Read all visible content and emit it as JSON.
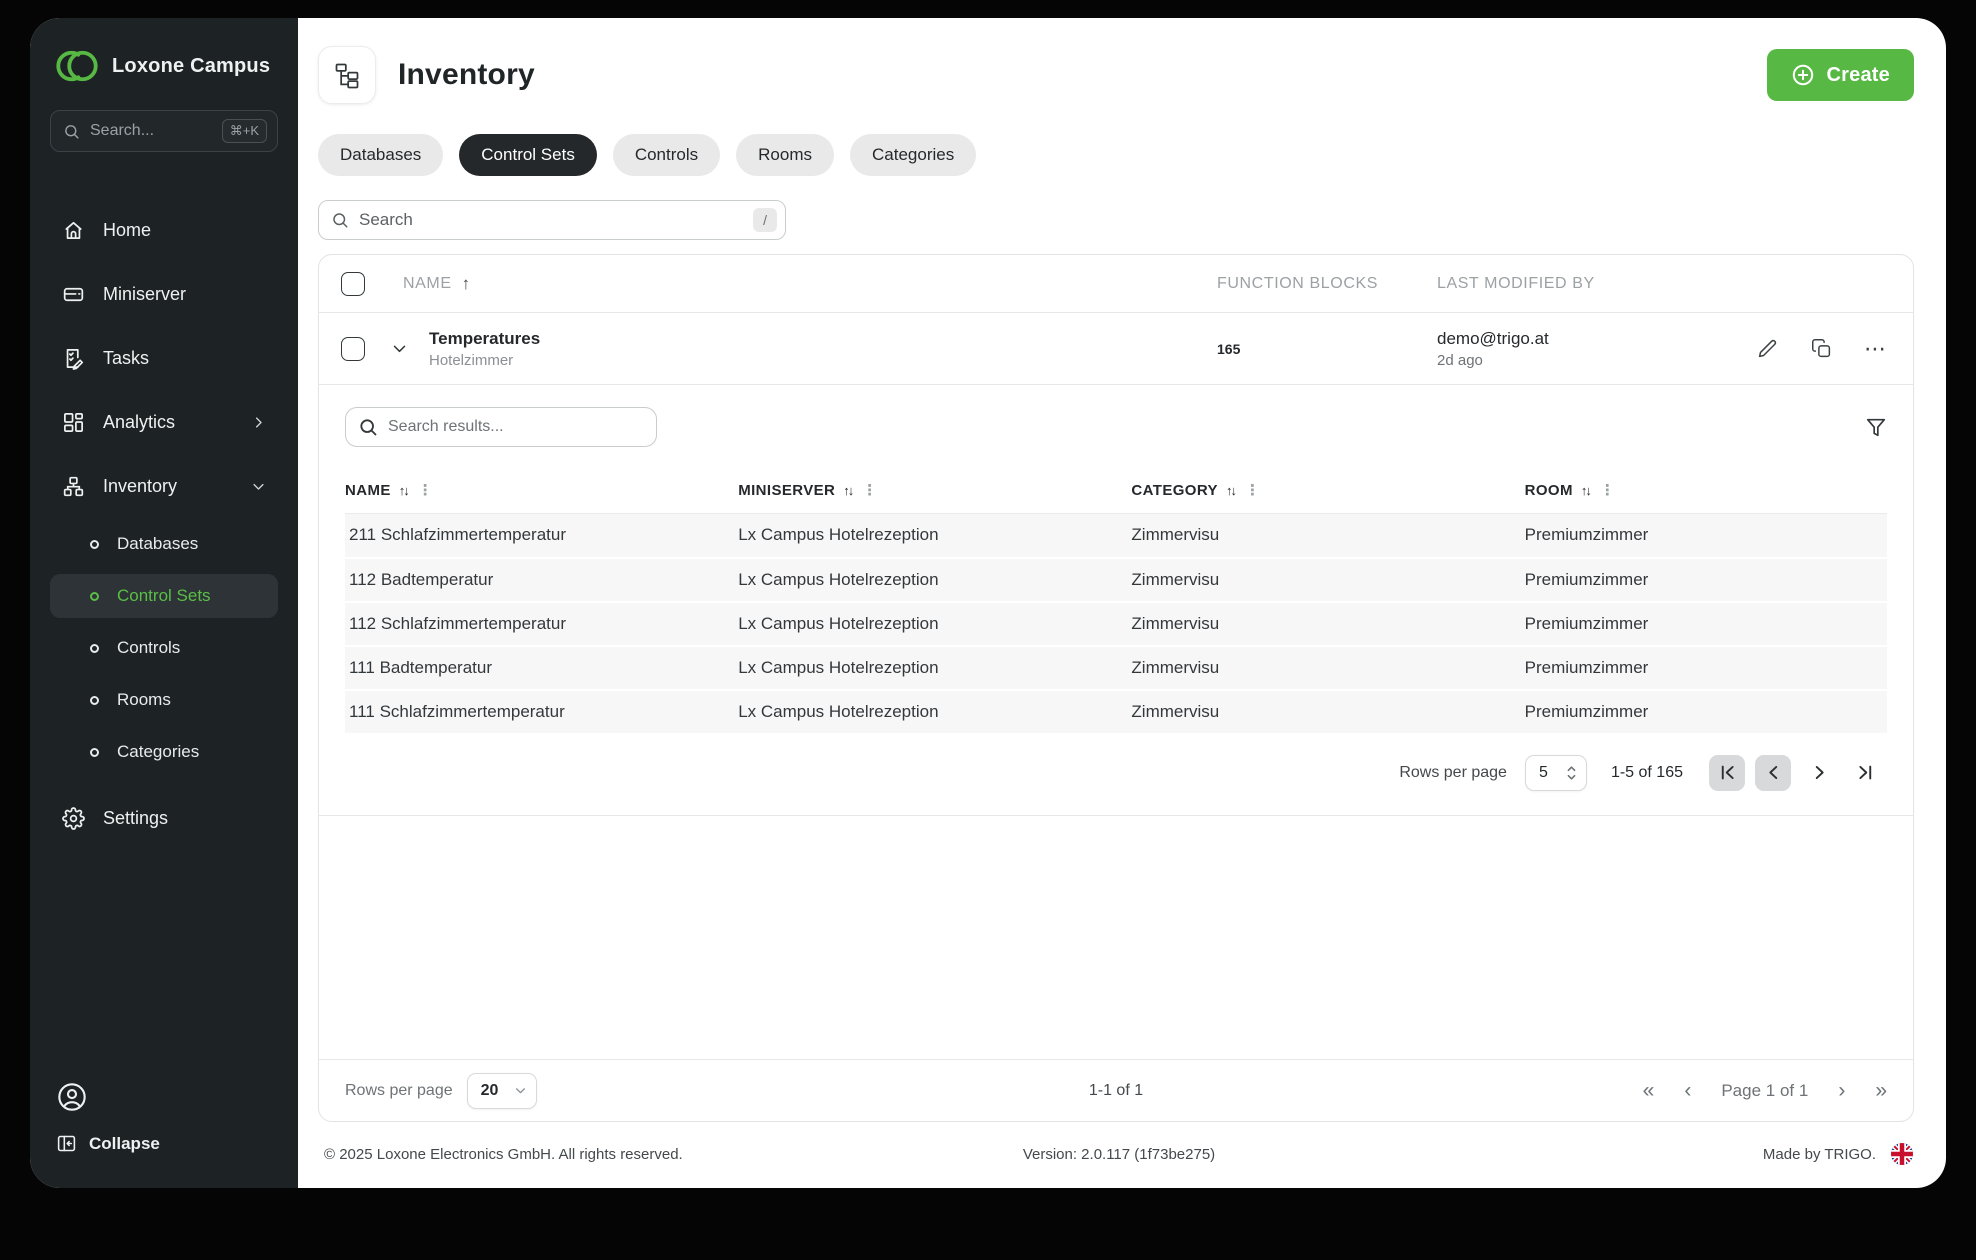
{
  "app": {
    "brand": "Loxone Campus"
  },
  "colors": {
    "accent_green": "#57b843",
    "sidebar_bg": "#1d2224",
    "active_tab_bg": "#24282b"
  },
  "sidebar": {
    "search": {
      "placeholder": "Search...",
      "shortcut": "⌘+K"
    },
    "items": [
      {
        "label": "Home"
      },
      {
        "label": "Miniserver"
      },
      {
        "label": "Tasks"
      },
      {
        "label": "Analytics"
      },
      {
        "label": "Inventory"
      }
    ],
    "inventory_children": [
      {
        "label": "Databases"
      },
      {
        "label": "Control Sets"
      },
      {
        "label": "Controls"
      },
      {
        "label": "Rooms"
      },
      {
        "label": "Categories"
      }
    ],
    "settings_label": "Settings",
    "collapse_label": "Collapse"
  },
  "header": {
    "title": "Inventory",
    "create_label": "Create"
  },
  "tabs": [
    {
      "label": "Databases"
    },
    {
      "label": "Control Sets"
    },
    {
      "label": "Controls"
    },
    {
      "label": "Rooms"
    },
    {
      "label": "Categories"
    }
  ],
  "search": {
    "placeholder": "Search",
    "shortcut": "/"
  },
  "table": {
    "headers": {
      "name": "NAME",
      "function_blocks": "FUNCTION BLOCKS",
      "last_modified_by": "LAST MODIFIED BY"
    },
    "row": {
      "name": "Temperatures",
      "subtitle": "Hotelzimmer",
      "function_blocks": "165",
      "modified_by": "demo@trigo.at",
      "modified_when": "2d ago"
    }
  },
  "subtable": {
    "search_placeholder": "Search results...",
    "columns": {
      "name": "NAME",
      "miniserver": "MINISERVER",
      "category": "CATEGORY",
      "room": "ROOM"
    },
    "rows": [
      {
        "name": "211 Schlafzimmertemperatur",
        "miniserver": "Lx Campus Hotelrezeption",
        "category": "Zimmervisu",
        "room": "Premiumzimmer"
      },
      {
        "name": "112 Badtemperatur",
        "miniserver": "Lx Campus Hotelrezeption",
        "category": "Zimmervisu",
        "room": "Premiumzimmer"
      },
      {
        "name": "112 Schlafzimmertemperatur",
        "miniserver": "Lx Campus Hotelrezeption",
        "category": "Zimmervisu",
        "room": "Premiumzimmer"
      },
      {
        "name": "111 Badtemperatur",
        "miniserver": "Lx Campus Hotelrezeption",
        "category": "Zimmervisu",
        "room": "Premiumzimmer"
      },
      {
        "name": "111 Schlafzimmertemperatur",
        "miniserver": "Lx Campus Hotelrezeption",
        "category": "Zimmervisu",
        "room": "Premiumzimmer"
      }
    ],
    "pagination": {
      "rows_per_page_label": "Rows per page",
      "page_size": "5",
      "range": "1-5 of 165"
    }
  },
  "bottom_bar": {
    "rows_per_page_label": "Rows per page",
    "page_size": "20",
    "range": "1-1 of 1",
    "page_indicator": "Page 1 of 1"
  },
  "footer": {
    "copyright": "© 2025 Loxone Electronics GmbH. All rights reserved.",
    "version": "Version: 2.0.117 (1f73be275)",
    "made_by": "Made by TRIGO."
  }
}
